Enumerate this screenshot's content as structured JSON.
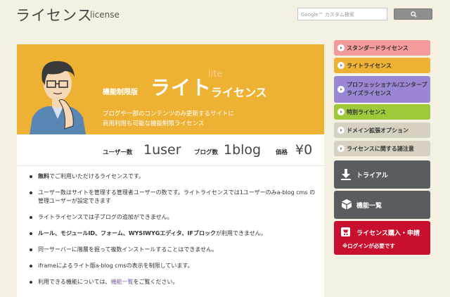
{
  "header": {
    "title_jp": "ライセンス",
    "title_en": "license",
    "search_placeholder": "Google™ カスタム検索"
  },
  "banner": {
    "feature_label": "機能制限版",
    "name_big": "ライト",
    "name_suffix": "ライセンス",
    "name_en": "lite",
    "desc_line1": "ブログや一部のコンテンツのみ更新するサイトに",
    "desc_line2": "商用利用も可能な機能制限ライセンス",
    "bg_color": "#edb133"
  },
  "stats": {
    "users_label": "ユーザー数",
    "users_value": "1user",
    "blogs_label": "ブログ数",
    "blogs_value": "1blog",
    "price_label": "価格",
    "price_value": "¥0"
  },
  "notes": {
    "n1_bold": "無料",
    "n1_rest": "でご利用いただけるライセンスです。",
    "n2": "ユーザー数はサイトを管理する管理者ユーザーの数です。ライトライセンスでは1ユーザーのみa-blog cms の管理ユーザーが設定できます",
    "n3": "ライトライセンスでは子ブログの追加ができません。",
    "n4_bold": "ルール、モジュールID、フォーム、WYSIWYGエディタ、IFブロック",
    "n4_rest": "が利用できません。",
    "n5": "同一サーバーに階層を掘って複数インストールすることはできません。",
    "n6": "iframeによるライト版a-blog cmsの表示を制限しています。",
    "n7_pre": "利用できる機能については、",
    "n7_link": "機能一覧",
    "n7_post": "をご覧ください。"
  },
  "sidebar": {
    "items": [
      {
        "label": "スタンダードライセンス",
        "color": "#f59a9a"
      },
      {
        "label": "ライトライセンス",
        "color": "#edb133"
      },
      {
        "label": "プロフェッショナル/エンタープライズライセンス",
        "color": "#9b86d4"
      },
      {
        "label": "特別ライセンス",
        "color": "#9dc93b"
      },
      {
        "label": "ドメイン拡張オプション",
        "color": "#d7d1c2"
      },
      {
        "label": "ライセンスに関する諸注意",
        "color": "#d7d1c2"
      }
    ],
    "trial_label": "トライアル",
    "features_label": "機能一覧",
    "purchase_label": "ライセンス購入・申請",
    "purchase_note": "※ログインが必要です",
    "trial_color": "#5a5d60",
    "purchase_color": "#c8102e"
  }
}
